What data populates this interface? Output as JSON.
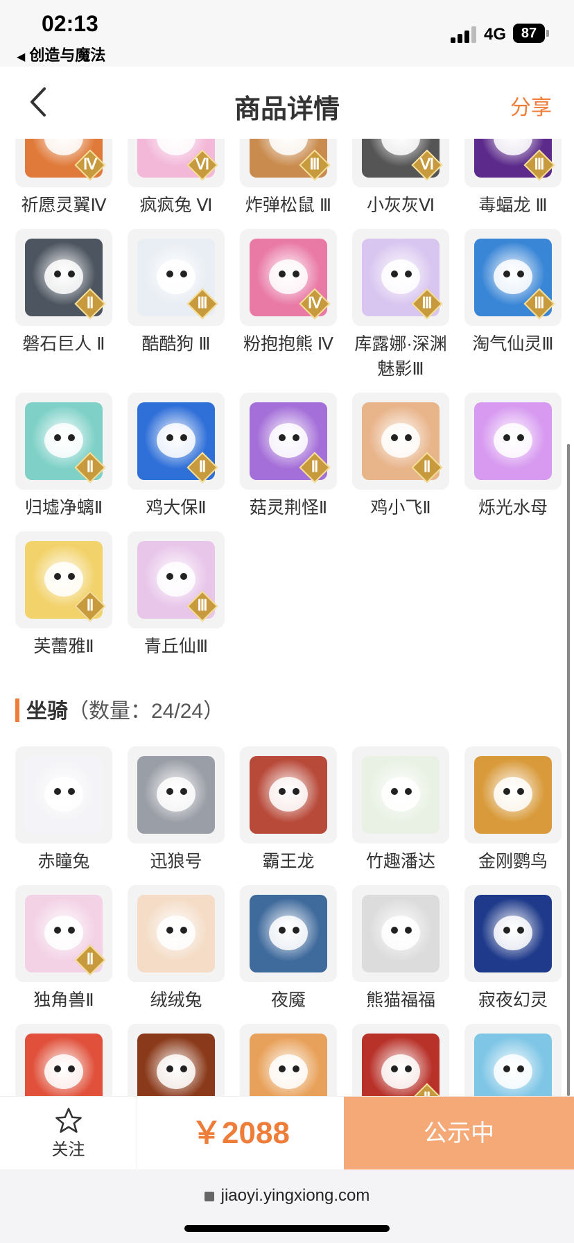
{
  "status": {
    "time": "02:13",
    "back_app": "创造与魔法",
    "network": "4G",
    "battery": "87"
  },
  "nav": {
    "title": "商品详情",
    "share": "分享"
  },
  "pets_row0": [
    {
      "label": "祈愿灵翼Ⅳ",
      "tier": "Ⅳ",
      "color": "#e07a3a"
    },
    {
      "label": "疯疯兔 Ⅵ",
      "tier": "Ⅵ",
      "color": "#f3b8d8"
    },
    {
      "label": "炸弹松鼠 Ⅲ",
      "tier": "Ⅲ",
      "color": "#c98b4e"
    },
    {
      "label": "小灰灰Ⅵ",
      "tier": "Ⅵ",
      "color": "#555555"
    },
    {
      "label": "毒蝠龙 Ⅲ",
      "tier": "Ⅲ",
      "color": "#5b2a8a"
    }
  ],
  "pets": [
    {
      "label": "磐石巨人 Ⅱ",
      "tier": "Ⅱ",
      "color": "#4d5560"
    },
    {
      "label": "酷酷狗 Ⅲ",
      "tier": "Ⅲ",
      "color": "#e9eef4"
    },
    {
      "label": "粉抱抱熊 Ⅳ",
      "tier": "Ⅳ",
      "color": "#e97aa6"
    },
    {
      "label": "库露娜·深渊魅影Ⅲ",
      "tier": "Ⅲ",
      "color": "#d9c6f0"
    },
    {
      "label": "淘气仙灵Ⅲ",
      "tier": "Ⅲ",
      "color": "#3a86d6"
    },
    {
      "label": "归墟净螭Ⅱ",
      "tier": "Ⅱ",
      "color": "#7fd1c8"
    },
    {
      "label": "鸡大保Ⅱ",
      "tier": "Ⅱ",
      "color": "#2f6fd8"
    },
    {
      "label": "菇灵荆怪Ⅱ",
      "tier": "Ⅱ",
      "color": "#a46fd8"
    },
    {
      "label": "鸡小飞Ⅱ",
      "tier": "Ⅱ",
      "color": "#e8b48a"
    },
    {
      "label": "烁光水母",
      "tier": "",
      "color": "#d79af0"
    },
    {
      "label": "芙蕾雅Ⅱ",
      "tier": "Ⅱ",
      "color": "#f2d26a"
    },
    {
      "label": "青丘仙Ⅲ",
      "tier": "Ⅲ",
      "color": "#e8c6ea"
    }
  ],
  "mounts_section": {
    "title": "坐骑",
    "count": "（数量：24/24）"
  },
  "mounts": [
    {
      "label": "赤瞳兔",
      "tier": "",
      "color": "#f4f4f8"
    },
    {
      "label": "迅狼号",
      "tier": "",
      "color": "#9a9ea6"
    },
    {
      "label": "霸王龙",
      "tier": "",
      "color": "#b84a3a"
    },
    {
      "label": "竹趣潘达",
      "tier": "",
      "color": "#e9f1e4"
    },
    {
      "label": "金刚鹦鸟",
      "tier": "",
      "color": "#d89a3a"
    },
    {
      "label": "独角兽Ⅱ",
      "tier": "Ⅱ",
      "color": "#f3d2e6"
    },
    {
      "label": "绒绒兔",
      "tier": "",
      "color": "#f4dcc6"
    },
    {
      "label": "夜魇",
      "tier": "",
      "color": "#3f6a9c"
    },
    {
      "label": "熊猫福福",
      "tier": "",
      "color": "#dcdcdc"
    },
    {
      "label": "寂夜幻灵",
      "tier": "",
      "color": "#1f3a8a"
    },
    {
      "label": "",
      "tier": "",
      "color": "#e0503a"
    },
    {
      "label": "",
      "tier": "",
      "color": "#8a3a1a"
    },
    {
      "label": "",
      "tier": "",
      "color": "#e8a15a"
    },
    {
      "label": "",
      "tier": "Ⅱ",
      "color": "#b8322a"
    },
    {
      "label": "",
      "tier": "",
      "color": "#7fc6e6"
    }
  ],
  "bottom": {
    "follow": "关注",
    "price": "￥2088",
    "action": "公示中"
  },
  "browser": {
    "url": "jiaoyi.yingxiong.com"
  },
  "colors": {
    "accent": "#ef7d3a",
    "action_bg": "#f4a977",
    "badge_gold": "#c89a3e"
  }
}
